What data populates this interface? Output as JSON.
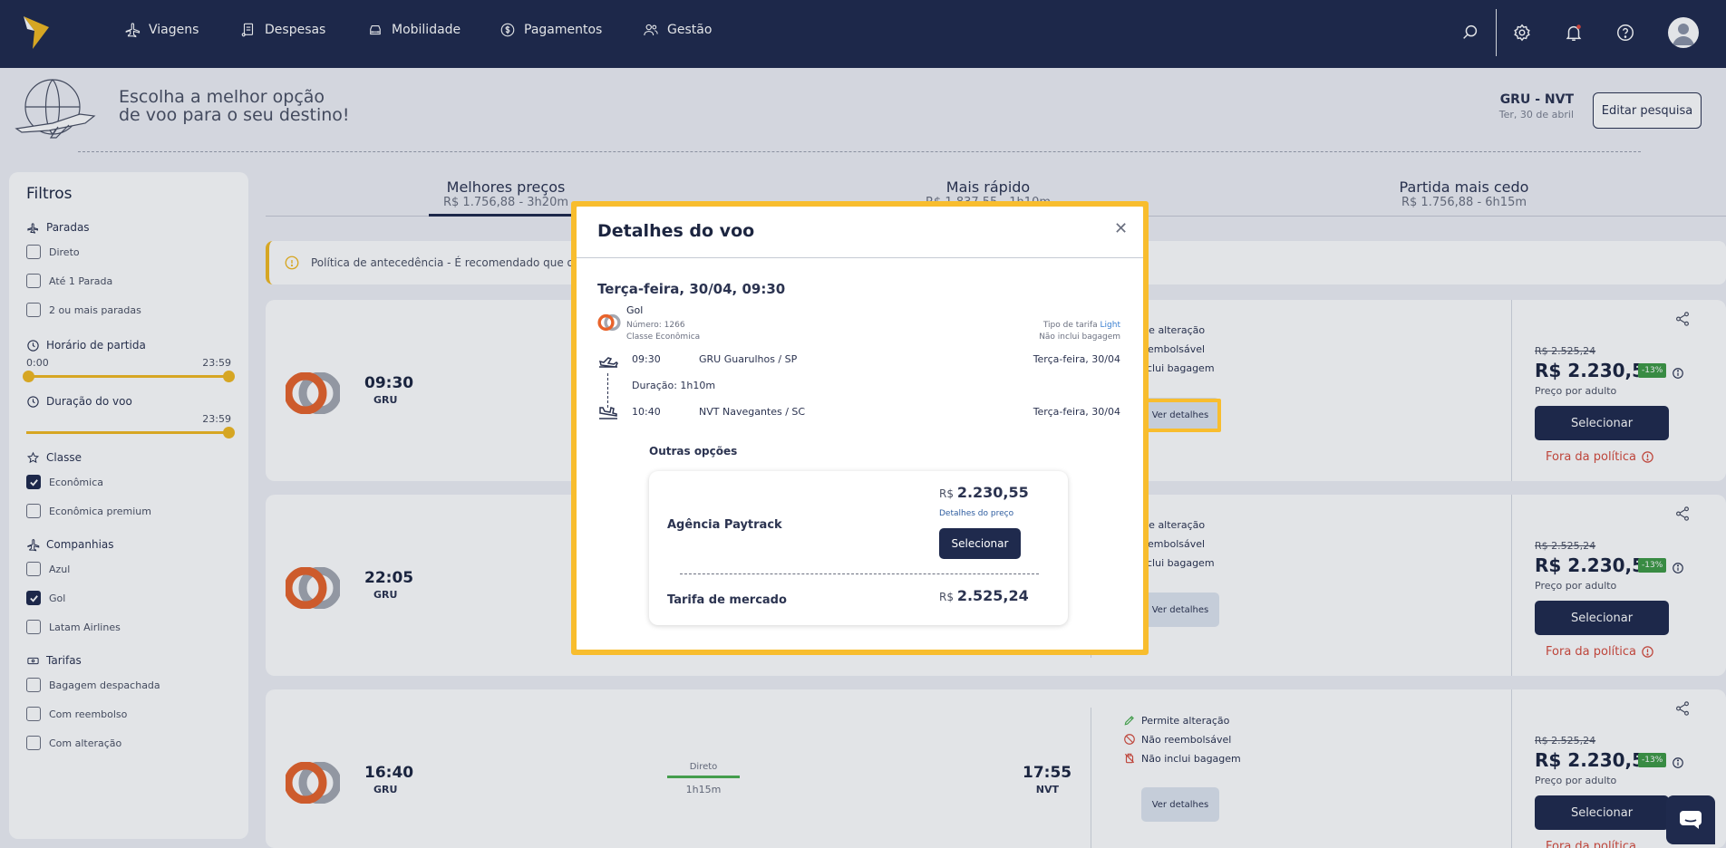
{
  "nav": {
    "items": [
      {
        "label": "Viagens",
        "icon": "plane-icon"
      },
      {
        "label": "Despesas",
        "icon": "receipt-icon"
      },
      {
        "label": "Mobilidade",
        "icon": "car-icon"
      },
      {
        "label": "Pagamentos",
        "icon": "dollar-icon"
      },
      {
        "label": "Gestão",
        "icon": "users-icon"
      }
    ]
  },
  "hero": {
    "line1": "Escolha a melhor opção",
    "line2": "de voo para o seu destino!"
  },
  "route": {
    "code": "GRU - NVT",
    "date": "Ter, 30 de abril",
    "edit_label": "Editar pesquisa"
  },
  "filters": {
    "title": "Filtros",
    "paradas": {
      "title": "Paradas",
      "options": [
        "Direto",
        "Até 1 Parada",
        "2 ou mais paradas"
      ]
    },
    "horario": {
      "title": "Horário de partida",
      "min": "0:00",
      "max": "23:59"
    },
    "duracao": {
      "title": "Duração do voo",
      "max": "23:59"
    },
    "classe": {
      "title": "Classe",
      "options": [
        "Econômica",
        "Econômica premium"
      ],
      "checked": [
        true,
        false
      ]
    },
    "companhias": {
      "title": "Companhias",
      "options": [
        "Azul",
        "Gol",
        "Latam Airlines"
      ],
      "checked": [
        false,
        true,
        false
      ]
    },
    "tarifas": {
      "title": "Tarifas",
      "options": [
        "Bagagem despachada",
        "Com reembolso",
        "Com alteração"
      ]
    }
  },
  "sort_tabs": [
    {
      "title": "Melhores preços",
      "sub": "R$ 1.756,88 - 3h20m"
    },
    {
      "title": "Mais rápido",
      "sub": "R$ 1.837,55 - 1h10m"
    },
    {
      "title": "Partida mais cedo",
      "sub": "R$ 1.756,88 - 6h15m"
    }
  ],
  "policy_notice": "Política de antecedência - É recomendado que os v",
  "cards": [
    {
      "dep_time": "09:30",
      "dep_code": "GRU",
      "old_price": "R$ 2.525,24",
      "price": "R$ 2.230,55",
      "discount": "-13%"
    },
    {
      "dep_time": "22:05",
      "dep_code": "GRU",
      "old_price": "R$ 2.525,24",
      "price": "R$ 2.230,55",
      "discount": "-13%"
    },
    {
      "dep_time": "16:40",
      "dep_code": "GRU",
      "arr_time": "17:55",
      "arr_code": "NVT",
      "stop": "Direto",
      "duration": "1h15m",
      "old_price": "R$ 2.525,24",
      "price": "R$ 2.230,55",
      "discount": "-13%"
    }
  ],
  "card_common": {
    "cond1": "Permite alteração",
    "cond2": "Não reembolsável",
    "cond3": "Não inclui bagagem",
    "cond1_short": "ermite alteração",
    "cond2_short": "ão reembolsável",
    "cond3_short": "ão inclui bagagem",
    "detail_btn": "Ver detalhes",
    "per_adult": "Preço por adulto",
    "select": "Selecionar",
    "out_policy": "Fora da política"
  },
  "modal": {
    "title": "Detalhes do voo",
    "date": "Terça-feira, 30/04, 09:30",
    "airline": "Gol",
    "number": "Número: 1266",
    "cabin": "Classe Econômica",
    "fare_label": "Tipo de tarifa",
    "fare_value": "Light",
    "baggage": "Não inclui bagagem",
    "dep_time": "09:30",
    "dep_airport": "GRU Guarulhos / SP",
    "dep_date": "Terça-feira, 30/04",
    "duration": "Duração: 1h10m",
    "arr_time": "10:40",
    "arr_airport": "NVT Navegantes / SC",
    "arr_date": "Terça-feira, 30/04",
    "other_title": "Outras opções",
    "agency": "Agência Paytrack",
    "currency": "R$",
    "agency_price": "2.230,55",
    "price_details": "Detalhes do preço",
    "select": "Selecionar",
    "market": "Tarifa de mercado",
    "market_price": "2.525,24"
  },
  "colors": {
    "navy": "#1f2a4d",
    "accent": "#f2b920",
    "highlight": "#f8bd2e",
    "discount": "#3e9a45",
    "danger": "#d64b3c"
  }
}
